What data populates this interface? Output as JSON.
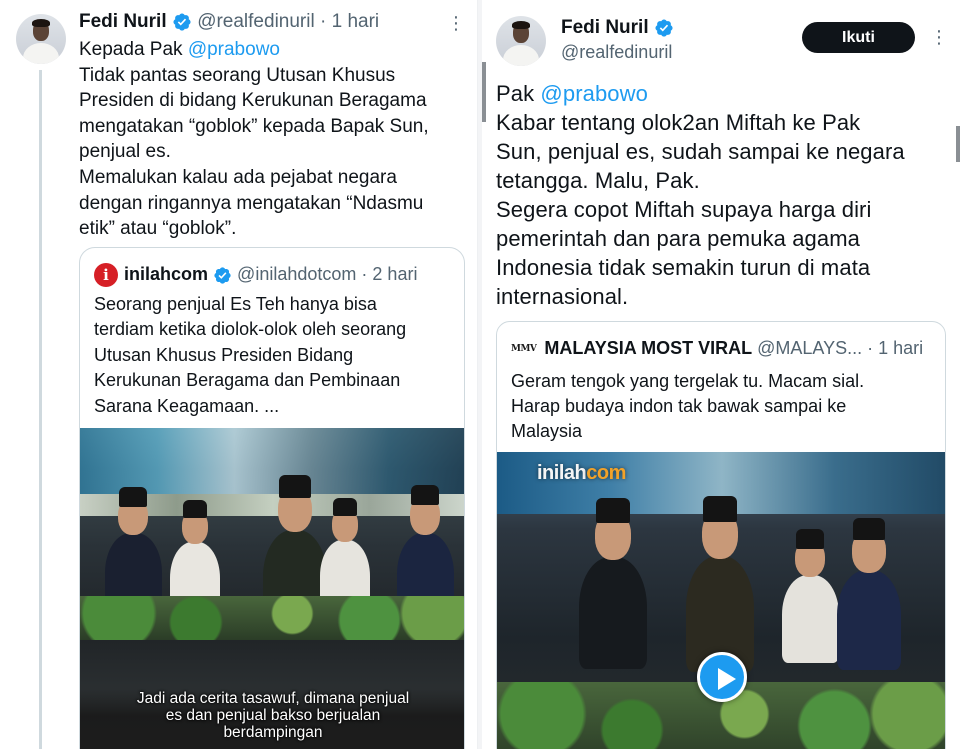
{
  "left_tweet": {
    "author_name": "Fedi Nuril",
    "author_handle": "@realfedinuril",
    "separator": "·",
    "time": "1 hari",
    "more": "⋮",
    "mention_prefix": "Kepada Pak ",
    "mention": "@prabowo",
    "lines": [
      "Tidak pantas seorang Utusan Khusus",
      "Presiden di bidang Kerukunan Beragama",
      "mengatakan “goblok” kepada Bapak Sun,",
      "penjual es.",
      "Memalukan kalau ada pejabat negara",
      "dengan ringannya mengatakan “Ndasmu",
      "etik” atau “goblok”."
    ],
    "quote": {
      "logo_letter": "i",
      "author_name": "inilahcom",
      "author_handle": "@inilahdotcom",
      "separator": "·",
      "time": "2 hari",
      "lines": [
        "Seorang penjual Es Teh hanya bisa",
        "terdiam ketika diolok-olok oleh seorang",
        "Utusan Khusus Presiden Bidang",
        "Kerukunan Beragama dan Pembinaan",
        "Sarana Keagamaan. ..."
      ],
      "video_caption": [
        "Jadi ada cerita tasawuf, dimana penjual",
        "es dan penjual bakso berjualan",
        "berdampingan"
      ]
    }
  },
  "right_tweet": {
    "author_name": "Fedi Nuril",
    "author_handle": "@realfedinuril",
    "follow_label": "Ikuti",
    "more": "⋮",
    "mention_prefix": "Pak ",
    "mention": "@prabowo",
    "lines": [
      "Kabar tentang olok2an Miftah ke Pak",
      "Sun, penjual es, sudah sampai ke negara",
      "tetangga. Malu, Pak.",
      "Segera copot Miftah supaya harga diri",
      "pemerintah dan para pemuka agama",
      "Indonesia tidak semakin turun di mata",
      "internasional."
    ],
    "quote": {
      "logo_text": "MMV",
      "author_name": "MALAYSIA MOST VIRAL",
      "author_handle": "@MALAYS...",
      "separator": "·",
      "time": "1 hari",
      "lines": [
        "Geram tengok yang tergelak tu. Macam sial.",
        "Harap budaya indon tak bawak sampai ke",
        "Malaysia"
      ],
      "watermark_main": "inilah",
      "watermark_dot": "com"
    }
  },
  "colors": {
    "accent": "#1d9bf0",
    "text": "#0f1419",
    "muted": "#536471",
    "border": "#cfd9de",
    "follow_bg": "#0f1419"
  }
}
